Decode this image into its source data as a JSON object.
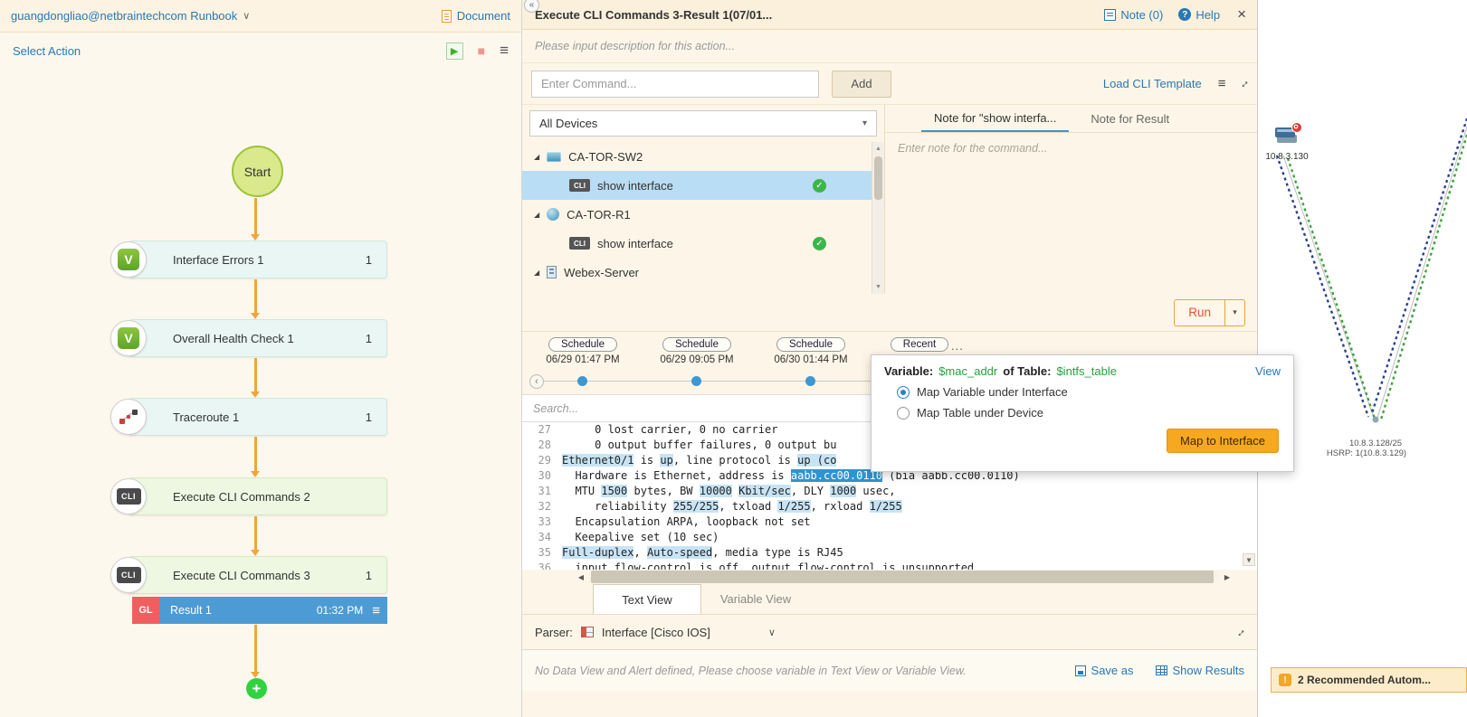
{
  "icons": {
    "chevron_down": "∨",
    "caret_down": "▾",
    "play": "▶",
    "stop": "■",
    "menu": "≡",
    "close": "×",
    "help_glyph": "?",
    "back": "‹",
    "collapse": "«",
    "expander": "◢",
    "check": "✓",
    "plus": "+",
    "up_arrow": "▲",
    "down_arrow": "▼",
    "left_arrow": "◀",
    "right_arrow": "▶",
    "more_ellipsis": "...",
    "cli_badge": "CLI",
    "v_badge": "V",
    "expand_diag": "↕",
    "notif_glyph": "!"
  },
  "colors": {
    "accent_blue": "#2878b5",
    "selection_blue": "#4d9bd5",
    "token_highlight": "#c7e4f5",
    "token_selected": "#2f93cf",
    "run_border_orange": "#e8a33c",
    "map_button_amber": "#f7a821",
    "success_green": "#3cb54a",
    "arrow_orange": "#f0a53c",
    "result_badge_red": "#f05f5f"
  },
  "left_panel": {
    "runbook_title": "guangdongliao@netbraintechcom Runbook",
    "document_label": "Document",
    "select_action_label": "Select Action",
    "flow": {
      "start_label": "Start",
      "nodes": [
        {
          "label": "Interface Errors 1",
          "count": "1",
          "type": "qapp"
        },
        {
          "label": "Overall Health Check 1",
          "count": "1",
          "type": "qapp"
        },
        {
          "label": "Traceroute 1",
          "count": "1",
          "type": "traceroute"
        },
        {
          "label": "Execute CLI Commands 2",
          "count": "",
          "type": "cli"
        },
        {
          "label": "Execute CLI Commands 3",
          "count": "1",
          "type": "cli"
        }
      ],
      "result_row": {
        "badge": "GL",
        "label": "Result 1",
        "time": "01:32 PM"
      }
    }
  },
  "main_panel": {
    "header": {
      "title": "Execute CLI Commands 3-Result 1(07/01...",
      "note_label": "Note (0)",
      "help_label": "Help"
    },
    "description_placeholder": "Please input description for this action...",
    "command_placeholder": "Enter Command...",
    "add_label": "Add",
    "load_cli_template_label": "Load CLI Template",
    "devices": {
      "dropdown_label": "All Devices",
      "tree": [
        {
          "label": "CA-TOR-SW2",
          "kind": "switch"
        },
        {
          "label": "show interface",
          "kind": "command",
          "selected": true,
          "status": "success"
        },
        {
          "label": "CA-TOR-R1",
          "kind": "router"
        },
        {
          "label": "show interface",
          "kind": "command",
          "selected": false,
          "status": "success"
        },
        {
          "label": "Webex-Server",
          "kind": "server"
        }
      ]
    },
    "note_tabs": {
      "command_tab": "Note for \"show interfa...",
      "result_tab": "Note for Result",
      "placeholder": "Enter note for the command..."
    },
    "run_label": "Run",
    "timeline": {
      "entries": [
        {
          "pill": "Schedule",
          "date": "06/29 01:47 PM"
        },
        {
          "pill": "Schedule",
          "date": "06/29 09:05 PM"
        },
        {
          "pill": "Schedule",
          "date": "06/30 01:44 PM"
        },
        {
          "pill": "Recent",
          "date": ""
        }
      ]
    },
    "search_placeholder": "Search...",
    "code": {
      "lines": [
        {
          "num": "27",
          "segments": [
            {
              "text": "     0 lost carrier, 0 no carrier"
            }
          ]
        },
        {
          "num": "28",
          "segments": [
            {
              "text": "     0 output buffer failures, 0 output bu"
            }
          ]
        },
        {
          "num": "29",
          "segments": [
            {
              "text": "Ethernet0/1",
              "hl": "blue"
            },
            {
              "text": " is "
            },
            {
              "text": "up",
              "hl": "blue"
            },
            {
              "text": ", line protocol is "
            },
            {
              "text": "up (co",
              "hl": "blue"
            }
          ]
        },
        {
          "num": "30",
          "segments": [
            {
              "text": "  Hardware is Ethernet, address is "
            },
            {
              "text": "aabb.cc00.0110",
              "hl": "selected"
            },
            {
              "text": " (bia aabb.cc00.0110)"
            }
          ]
        },
        {
          "num": "31",
          "segments": [
            {
              "text": "  MTU "
            },
            {
              "text": "1500",
              "hl": "blue"
            },
            {
              "text": " bytes, BW "
            },
            {
              "text": "10000",
              "hl": "blue"
            },
            {
              "text": " "
            },
            {
              "text": "Kbit/sec",
              "hl": "blue"
            },
            {
              "text": ", DLY "
            },
            {
              "text": "1000",
              "hl": "blue"
            },
            {
              "text": " usec,"
            }
          ]
        },
        {
          "num": "32",
          "segments": [
            {
              "text": "     reliability "
            },
            {
              "text": "255/255",
              "hl": "blue"
            },
            {
              "text": ", txload "
            },
            {
              "text": "1/255",
              "hl": "blue"
            },
            {
              "text": ", rxload "
            },
            {
              "text": "1/255",
              "hl": "blue"
            }
          ]
        },
        {
          "num": "33",
          "segments": [
            {
              "text": "  Encapsulation ARPA, loopback not set"
            }
          ]
        },
        {
          "num": "34",
          "segments": [
            {
              "text": "  Keepalive set (10 sec)"
            }
          ]
        },
        {
          "num": "35",
          "segments": [
            {
              "text": "Full-duplex",
              "hl": "blue"
            },
            {
              "text": ", "
            },
            {
              "text": "Auto-speed",
              "hl": "blue"
            },
            {
              "text": ", media type is RJ45"
            }
          ]
        },
        {
          "num": "36",
          "segments": [
            {
              "text": "  input flow-control is off, output flow-control is unsupported"
            }
          ]
        },
        {
          "num": "37",
          "segments": [
            {
              "text": ""
            }
          ]
        }
      ]
    },
    "view_tabs": {
      "text_view": "Text View",
      "variable_view": "Variable View"
    },
    "parser": {
      "label": "Parser:",
      "value": "Interface [Cisco IOS]"
    },
    "status_text": "No Data View and Alert defined, Please choose variable in Text View or Variable View.",
    "save_as_label": "Save as",
    "show_results_label": "Show Results"
  },
  "popup": {
    "variable_label": "Variable:",
    "variable_name": "$mac_addr",
    "table_label": "of Table:",
    "table_name": "$intfs_table",
    "view_label": "View",
    "options": [
      {
        "label": "Map Variable under Interface",
        "checked": true
      },
      {
        "label": "Map Table under Device",
        "checked": false
      }
    ],
    "map_button_label": "Map to Interface"
  },
  "map_panel": {
    "device_label": "10.8.3.130",
    "subnet_label": "10.8.3.128/25",
    "hsrp_label": "HSRP: 1(10.8.3.129)",
    "notification_label": "2 Recommended Autom..."
  }
}
